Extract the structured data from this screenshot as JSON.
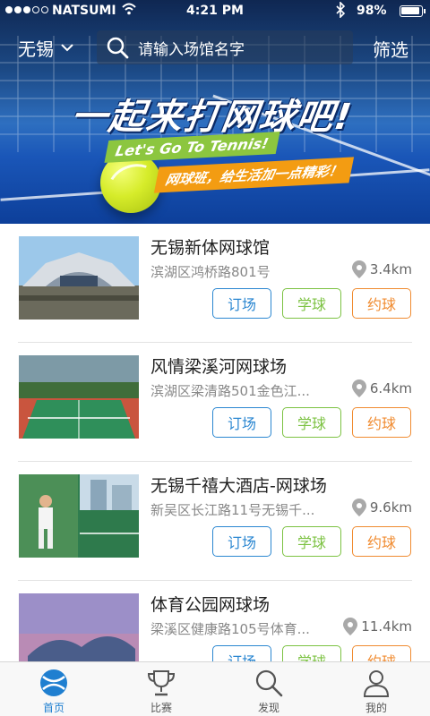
{
  "status_bar": {
    "carrier": "NATSUMI",
    "time": "4:21 PM",
    "battery": "98%",
    "battery_level": 0.98
  },
  "header": {
    "city": "无锡",
    "search_placeholder": "请输入场馆名字",
    "filter_label": "筛选"
  },
  "banner": {
    "title": "一起来打网球吧!",
    "subtitle_en": "Let's Go To Tennis!",
    "slogan": "网球班，给生活加一点精彩！"
  },
  "venues": [
    {
      "name": "无锡新体网球馆",
      "address": "滨湖区鸿桥路801号",
      "distance": "3.4km"
    },
    {
      "name": "风情梁溪河网球场",
      "address": "滨湖区梁清路501金色江...",
      "distance": "6.4km"
    },
    {
      "name": "无锡千禧大酒店-网球场",
      "address": "新吴区长江路11号无锡千...",
      "distance": "9.6km"
    },
    {
      "name": "体育公园网球场",
      "address": "梁溪区健康路105号体育...",
      "distance": "11.4km"
    }
  ],
  "buttons": {
    "book": "订场",
    "learn": "学球",
    "meet": "约球"
  },
  "tabs": [
    {
      "label": "首页",
      "icon": "home-ball-icon",
      "active": true
    },
    {
      "label": "比赛",
      "icon": "trophy-icon",
      "active": false
    },
    {
      "label": "发现",
      "icon": "search-icon",
      "active": false
    },
    {
      "label": "我的",
      "icon": "user-icon",
      "active": false
    }
  ],
  "colors": {
    "primary": "#2b87d1",
    "learn": "#7cc242",
    "meet": "#f08b30",
    "tab_active": "#1f7fd0"
  }
}
